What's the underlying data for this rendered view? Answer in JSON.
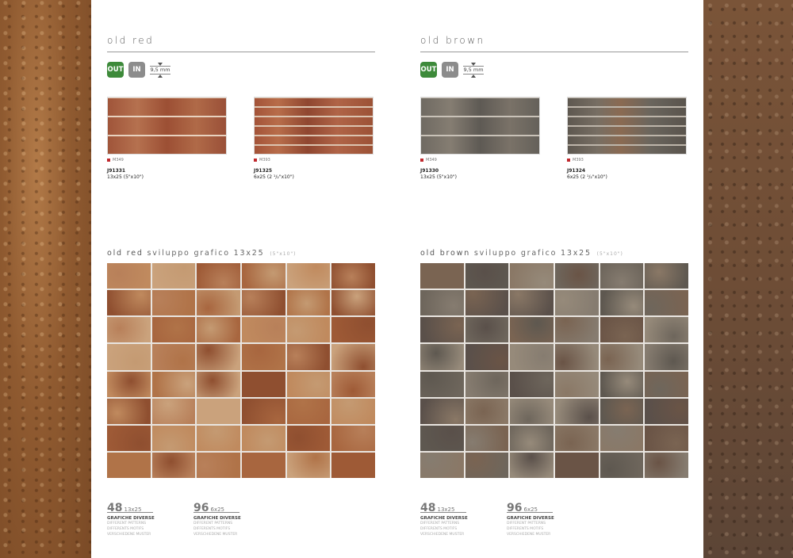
{
  "colors": {
    "out_badge": "#3d8a3a",
    "in_badge": "#8c8c8c",
    "code_square": "#c0282d"
  },
  "columns": [
    {
      "title": "old red",
      "badges": {
        "out": "OUT",
        "in": "IN",
        "thickness": "9,5 mm"
      },
      "products": [
        {
          "small_code": "M349",
          "code": "J91331",
          "size": "13x25 (5\"x10\")"
        },
        {
          "small_code": "M393",
          "code": "J91325",
          "size": "6x25 (2 ¹/₂\"x10\")"
        }
      ],
      "grid": {
        "title_name": "old red",
        "title_suffix": "sviluppo grafico 13x25",
        "title_size": "(5\"x10\")"
      },
      "stats": [
        {
          "number": "48",
          "size": "13x25",
          "label1": "GRAFICHE DIVERSE",
          "label2": "DIFFERENT PATTERNS",
          "label3": "DIFFERENTS MOTIFS",
          "label4": "VERSCHIEDENE MUSTER"
        },
        {
          "number": "96",
          "size": "6x25",
          "label1": "GRAFICHE DIVERSE",
          "label2": "DIFFERENT PATTERNS",
          "label3": "DIFFERENTS MOTIFS",
          "label4": "VERSCHIEDENE MUSTER"
        }
      ]
    },
    {
      "title": "old brown",
      "badges": {
        "out": "OUT",
        "in": "IN",
        "thickness": "9,5 mm"
      },
      "products": [
        {
          "small_code": "M349",
          "code": "J91330",
          "size": "13x25 (5\"x10\")"
        },
        {
          "small_code": "M393",
          "code": "J91324",
          "size": "6x25 (2 ¹/₂\"x10\")"
        }
      ],
      "grid": {
        "title_name": "old brown",
        "title_suffix": "sviluppo grafico 13x25",
        "title_size": "(5\"x10\")"
      },
      "stats": [
        {
          "number": "48",
          "size": "13x25",
          "label1": "GRAFICHE DIVERSE",
          "label2": "DIFFERENT PATTERNS",
          "label3": "DIFFERENTS MOTIFS",
          "label4": "VERSCHIEDENE MUSTER"
        },
        {
          "number": "96",
          "size": "6x25",
          "label1": "GRAFICHE DIVERSE",
          "label2": "DIFFERENT PATTERNS",
          "label3": "DIFFERENTS MOTIFS",
          "label4": "VERSCHIEDENE MUSTER"
        }
      ]
    }
  ]
}
